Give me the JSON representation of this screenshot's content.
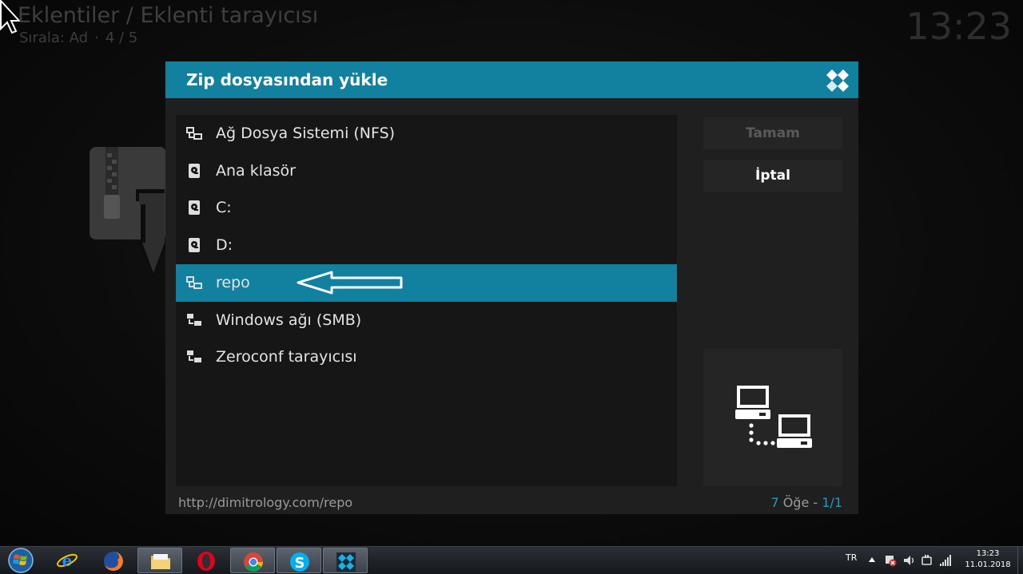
{
  "background": {
    "title": "Eklentiler / Eklenti tarayıcısı",
    "sort_label": "Sırala: Ad",
    "sort_separator": "·",
    "position": "4 / 5",
    "clock": "13:23",
    "addon_icon": "zip-install-icon"
  },
  "dialog": {
    "title": "Zip dosyasından yükle",
    "logo_icon": "kodi-logo-icon",
    "items": [
      {
        "label": "Ağ Dosya Sistemi (NFS)",
        "icon": "network-share-icon"
      },
      {
        "label": "Ana klasör",
        "icon": "hard-drive-icon"
      },
      {
        "label": "C:",
        "icon": "hard-drive-icon"
      },
      {
        "label": "D:",
        "icon": "hard-drive-icon"
      },
      {
        "label": "repo",
        "icon": "network-share-icon",
        "selected": true
      },
      {
        "label": "Windows ağı (SMB)",
        "icon": "network-icon"
      },
      {
        "label": "Zeroconf tarayıcısı",
        "icon": "network-icon"
      }
    ],
    "ok_label": "Tamam",
    "cancel_label": "İptal",
    "preview_icon": "network-computers-icon",
    "path": "http://dimitrology.com/repo",
    "count_number": "7",
    "count_word": " Öğe - ",
    "page": "1/1",
    "accent_color": "#12809f"
  },
  "taskbar": {
    "apps": [
      {
        "name": "internet-explorer",
        "icon": "internet-explorer-icon"
      },
      {
        "name": "firefox",
        "icon": "firefox-icon"
      },
      {
        "name": "file-explorer",
        "icon": "folder-icon",
        "active": true
      },
      {
        "name": "opera",
        "icon": "opera-icon"
      },
      {
        "name": "chrome",
        "icon": "chrome-icon",
        "active": true
      },
      {
        "name": "skype",
        "icon": "skype-icon",
        "active": true
      },
      {
        "name": "kodi",
        "icon": "kodi-icon",
        "active": true
      }
    ],
    "language": "TR",
    "time": "13:23",
    "date": "11.01.2018"
  }
}
